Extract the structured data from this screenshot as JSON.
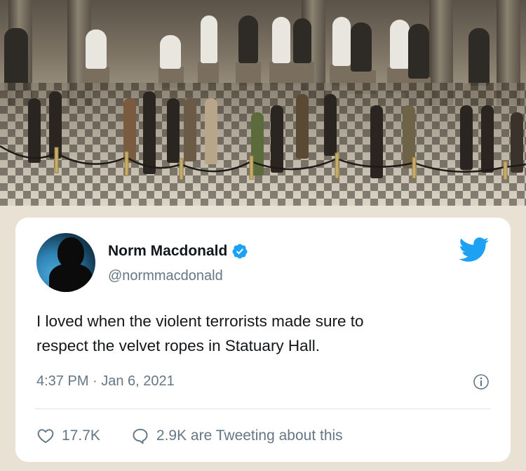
{
  "photo": {
    "description_icon": "photo-statuary-hall"
  },
  "tweet": {
    "display_name": "Norm Macdonald",
    "handle": "@normmacdonald",
    "text_line1": "I loved when the violent terrorists made sure to",
    "text_line2": "respect the velvet ropes in Statuary Hall.",
    "timestamp": "4:37 PM · Jan 6, 2021",
    "likes": "17.7K",
    "replies_text": "2.9K are Tweeting about this"
  },
  "colors": {
    "twitter_blue": "#1da1f2",
    "text_primary": "#14171a",
    "text_secondary": "#657786"
  },
  "icons": {
    "verified": "verified-badge-icon",
    "brand": "twitter-bird-icon",
    "info": "info-icon",
    "like": "heart-icon",
    "reply": "speech-bubble-icon"
  }
}
